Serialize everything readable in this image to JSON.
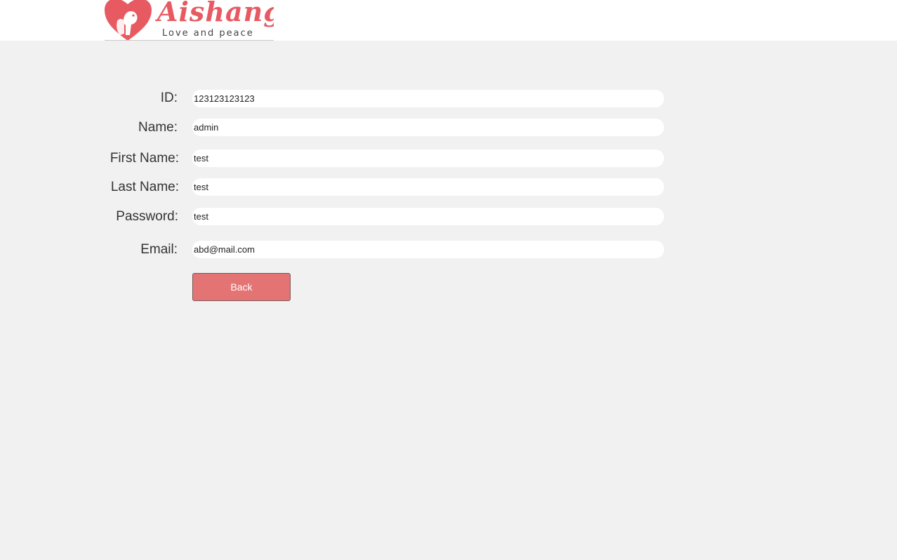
{
  "brand": {
    "name": "Aishang",
    "tagline": "Love and peace",
    "color": "#e85a62",
    "logo_icon": "heart-with-dog-and-cat-icon"
  },
  "form": {
    "id": {
      "label": "ID:",
      "value": "123123123123"
    },
    "name": {
      "label": "Name:",
      "value": "admin"
    },
    "first_name": {
      "label": "First Name:",
      "value": "test"
    },
    "last_name": {
      "label": "Last Name:",
      "value": "test"
    },
    "password": {
      "label": "Password:",
      "value": "test"
    },
    "email": {
      "label": "Email:",
      "value": "abd@mail.com"
    }
  },
  "actions": {
    "back_label": "Back",
    "back_color": "#e47474"
  }
}
